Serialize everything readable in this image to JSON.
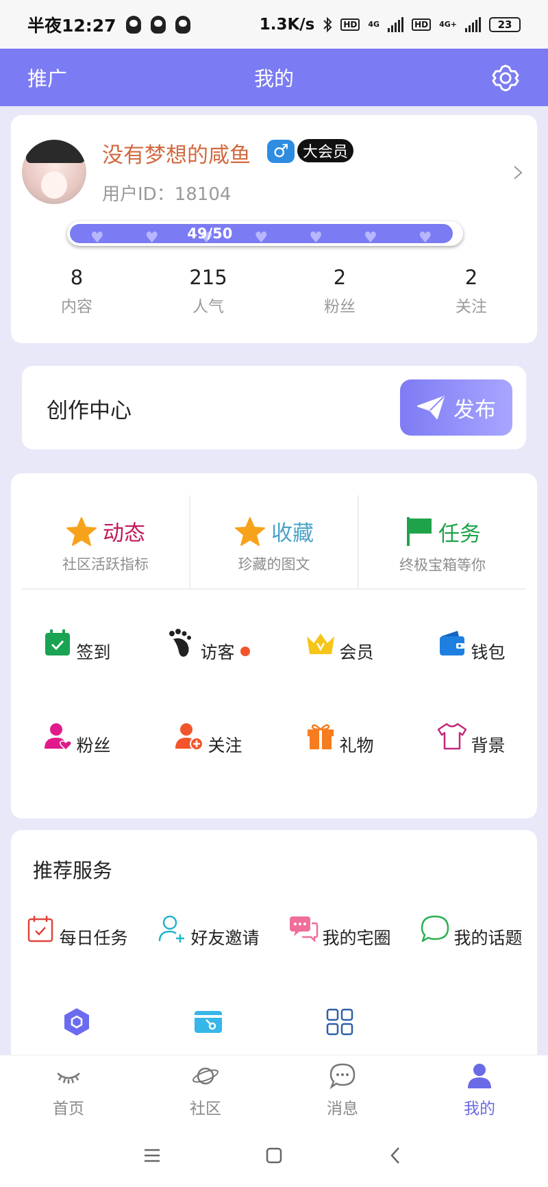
{
  "status_bar": {
    "time": "半夜12:27",
    "speed": "1.3K/s",
    "net1": "4G",
    "net2": "4G+",
    "battery": "23"
  },
  "topbar": {
    "promo": "推广",
    "title": "我的"
  },
  "profile": {
    "username": "没有梦想的咸鱼",
    "gender_symbol": "♂",
    "badge": "大会员",
    "user_id": "用户ID：18104",
    "progress_text": "49/50",
    "progress_fraction": 0.98,
    "stats": [
      {
        "value": "8",
        "label": "内容"
      },
      {
        "value": "215",
        "label": "人气"
      },
      {
        "value": "2",
        "label": "粉丝"
      },
      {
        "value": "2",
        "label": "关注"
      }
    ]
  },
  "creator": {
    "label": "创作中心",
    "publish": "发布"
  },
  "features": [
    {
      "title": "动态",
      "sub": "社区活跃指标",
      "color": "#c2185b",
      "icon": "star-icon"
    },
    {
      "title": "收藏",
      "sub": "珍藏的图文",
      "color": "#4aa3c8",
      "icon": "star-icon"
    },
    {
      "title": "任务",
      "sub": "终极宝箱等你",
      "color": "#1fa34a",
      "icon": "flag-icon"
    }
  ],
  "grid": [
    {
      "label": "签到",
      "icon": "calendar-check-icon",
      "color": "#1aa352"
    },
    {
      "label": "访客",
      "icon": "footprint-icon",
      "color": "#222222",
      "dot": true
    },
    {
      "label": "会员",
      "icon": "crown-icon",
      "color": "#f5c518"
    },
    {
      "label": "钱包",
      "icon": "wallet-icon",
      "color": "#1e7fe0"
    },
    {
      "label": "粉丝",
      "icon": "user-heart-icon",
      "color": "#e01a8a"
    },
    {
      "label": "关注",
      "icon": "user-add-icon",
      "color": "#f2552c"
    },
    {
      "label": "礼物",
      "icon": "gift-icon",
      "color": "#f57c1f"
    },
    {
      "label": "背景",
      "icon": "tshirt-icon",
      "color": "#c2287a"
    }
  ],
  "services": {
    "title": "推荐服务",
    "items": [
      {
        "label": "每日任务",
        "icon": "calendar-icon",
        "color": "#e0443c"
      },
      {
        "label": "好友邀请",
        "icon": "user-plus-icon",
        "color": "#22b5c8"
      },
      {
        "label": "我的宅圈",
        "icon": "chat-bubbles-icon",
        "color": "#ef6f9a"
      },
      {
        "label": "我的话题",
        "icon": "chat-bubble-icon",
        "color": "#2bb04f"
      }
    ],
    "row2_icons": [
      {
        "icon": "hexagon-icon",
        "color": "#6b6bf0"
      },
      {
        "icon": "card-key-icon",
        "color": "#36b6e9"
      },
      {
        "icon": "grid-apps-icon",
        "color": "#2d5fa8"
      }
    ]
  },
  "bottom_nav": [
    {
      "label": "首页",
      "icon": "eye-closed-icon"
    },
    {
      "label": "社区",
      "icon": "planet-icon"
    },
    {
      "label": "消息",
      "icon": "message-icon"
    },
    {
      "label": "我的",
      "icon": "user-icon",
      "active": true
    }
  ]
}
